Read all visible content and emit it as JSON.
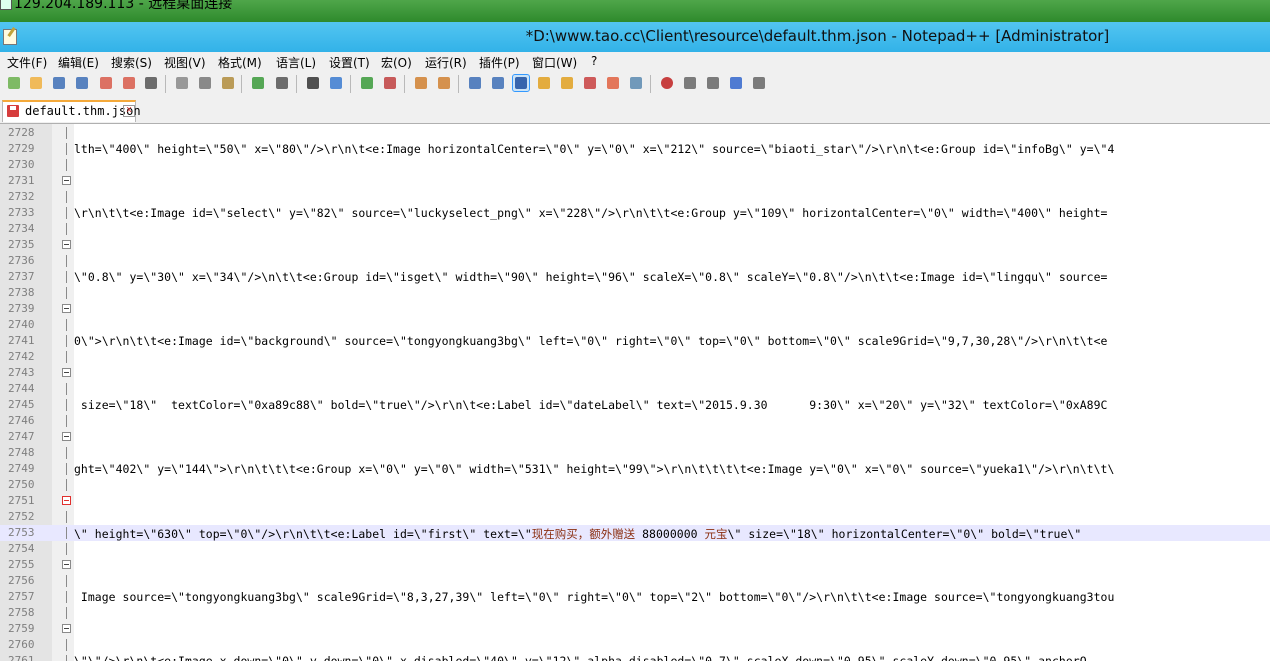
{
  "rdp": {
    "title": "129.204.189.113 - 远程桌面连接"
  },
  "window": {
    "title": "*D:\\www.tao.cc\\Client\\resource\\default.thm.json - Notepad++ [Administrator]"
  },
  "menu": [
    "文件(F)",
    "编辑(E)",
    "搜索(S)",
    "视图(V)",
    "格式(M)",
    "语言(L)",
    "设置(T)",
    "宏(O)",
    "运行(R)",
    "插件(P)",
    "窗口(W)",
    "?"
  ],
  "toolbar": {
    "icons": [
      "new-file-icon",
      "open-file-icon",
      "save-icon",
      "save-all-icon",
      "close-icon",
      "close-all-icon",
      "print-icon",
      "cut-icon",
      "copy-icon",
      "paste-icon",
      "undo-icon",
      "redo-icon",
      "find-icon",
      "replace-icon",
      "zoom-in-icon",
      "zoom-out-icon",
      "sync-vertical-icon",
      "sync-horizontal-icon",
      "word-wrap-icon",
      "show-all-chars-icon",
      "indent-guide-icon",
      "user-language-icon",
      "doc-map-icon",
      "function-list-icon",
      "folder-workspace-icon",
      "monitoring-icon",
      "record-macro-icon",
      "stop-macro-icon",
      "play-macro-icon",
      "run-macro-multiple-icon",
      "save-macro-icon"
    ]
  },
  "tab": {
    "label": "default.thm.json",
    "close": "x"
  },
  "editor": {
    "lines": [
      {
        "n": "2728",
        "text": "",
        "fold": false
      },
      {
        "n": "2729",
        "text": "lth=\\\"400\\\" height=\\\"50\\\" x=\\\"80\\\"/>\\r\\n\\t<e:Image horizontalCenter=\\\"0\\\" y=\\\"0\\\" x=\\\"212\\\" source=\\\"biaoti_star\\\"/>\\r\\n\\t<e:Group id=\\\"infoBg\\\" y=\\\"4",
        "fold": false
      },
      {
        "n": "2730",
        "text": "",
        "fold": false
      },
      {
        "n": "2731",
        "text": "",
        "fold": true
      },
      {
        "n": "2732",
        "text": "",
        "fold": false
      },
      {
        "n": "2733",
        "text": "\\r\\n\\t\\t<e:Image id=\\\"select\\\" y=\\\"82\\\" source=\\\"luckyselect_png\\\" x=\\\"228\\\"/>\\r\\n\\t\\t<e:Group y=\\\"109\\\" horizontalCenter=\\\"0\\\" width=\\\"400\\\" height=",
        "fold": false
      },
      {
        "n": "2734",
        "text": "",
        "fold": false
      },
      {
        "n": "2735",
        "text": "",
        "fold": true
      },
      {
        "n": "2736",
        "text": "",
        "fold": false
      },
      {
        "n": "2737",
        "text": "\\\"0.8\\\" y=\\\"30\\\" x=\\\"34\\\"/>\\n\\t\\t<e:Group id=\\\"isget\\\" width=\\\"90\\\" height=\\\"96\\\" scaleX=\\\"0.8\\\" scaleY=\\\"0.8\\\"/>\\n\\t\\t<e:Image id=\\\"lingqu\\\" source=",
        "fold": false
      },
      {
        "n": "2738",
        "text": "",
        "fold": false
      },
      {
        "n": "2739",
        "text": "",
        "fold": true
      },
      {
        "n": "2740",
        "text": "",
        "fold": false
      },
      {
        "n": "2741",
        "text": "0\\\">\\r\\n\\t\\t<e:Image id=\\\"background\\\" source=\\\"tongyongkuang3bg\\\" left=\\\"0\\\" right=\\\"0\\\" top=\\\"0\\\" bottom=\\\"0\\\" scale9Grid=\\\"9,7,30,28\\\"/>\\r\\n\\t\\t<e",
        "fold": false
      },
      {
        "n": "2742",
        "text": "",
        "fold": false
      },
      {
        "n": "2743",
        "text": "",
        "fold": true
      },
      {
        "n": "2744",
        "text": "",
        "fold": false
      },
      {
        "n": "2745",
        "text": " size=\\\"18\\\"  textColor=\\\"0xa89c88\\\" bold=\\\"true\\\"/>\\r\\n\\t<e:Label id=\\\"dateLabel\\\" text=\\\"2015.9.30      9:30\\\" x=\\\"20\\\" y=\\\"32\\\" textColor=\\\"0xA89C",
        "fold": false
      },
      {
        "n": "2746",
        "text": "",
        "fold": false
      },
      {
        "n": "2747",
        "text": "",
        "fold": true
      },
      {
        "n": "2748",
        "text": "",
        "fold": false
      },
      {
        "n": "2749",
        "text": "ght=\\\"402\\\" y=\\\"144\\\">\\r\\n\\t\\t\\t<e:Group x=\\\"0\\\" y=\\\"0\\\" width=\\\"531\\\" height=\\\"99\\\">\\r\\n\\t\\t\\t\\t<e:Image y=\\\"0\\\" x=\\\"0\\\" source=\\\"yueka1\\\"/>\\r\\n\\t\\t\\",
        "fold": false
      },
      {
        "n": "2750",
        "text": "",
        "fold": false
      },
      {
        "n": "2751",
        "text": "",
        "fold": true,
        "red": true
      },
      {
        "n": "2752",
        "text": "",
        "fold": false
      },
      {
        "n": "2753",
        "text": "\\\" height=\\\"630\\\" top=\\\"0\\\"/>\\r\\n\\t\\t<e:Label id=\\\"first\\\" text=\\\"现在购买，额外赠送 88000000 元宝\\\" size=\\\"18\\\" horizontalCenter=\\\"0\\\" bold=\\\"true\\\"",
        "fold": false,
        "current": true
      },
      {
        "n": "2754",
        "text": "",
        "fold": false
      },
      {
        "n": "2755",
        "text": "",
        "fold": true
      },
      {
        "n": "2756",
        "text": "",
        "fold": false
      },
      {
        "n": "2757",
        "text": " Image source=\\\"tongyongkuang3bg\\\" scale9Grid=\\\"8,3,27,39\\\" left=\\\"0\\\" right=\\\"0\\\" top=\\\"2\\\" bottom=\\\"0\\\"/>\\r\\n\\t\\t<e:Image source=\\\"tongyongkuang3tou",
        "fold": false
      },
      {
        "n": "2758",
        "text": "",
        "fold": false
      },
      {
        "n": "2759",
        "text": "",
        "fold": true
      },
      {
        "n": "2760",
        "text": "",
        "fold": false
      },
      {
        "n": "2761",
        "text": "\\\"\\\"/>\\r\\n\\t<e:Image x_down=\\\"0\\\" y_down=\\\"0\\\" x_disabled=\\\"40\\\" y=\\\"12\\\" alpha_disabled=\\\"0.7\\\" scaleX_down=\\\"0.95\\\" scaleY_down=\\\"0.95\\\" anchorO",
        "fold": false
      }
    ]
  }
}
